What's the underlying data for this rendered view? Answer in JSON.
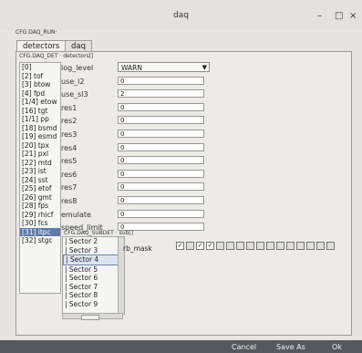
{
  "window": {
    "title": "daq",
    "minimize": "–",
    "maximize": "□",
    "close": "×"
  },
  "cfg_run_label": "CFG.DAQ_RUN·",
  "tabs": [
    {
      "label": "detectors"
    },
    {
      "label": "daq"
    }
  ],
  "detectors_header": "CFG.DAQ_DET · detectors[]",
  "detectors": [
    "[0]",
    "[2] tof",
    "[3] btow",
    "[4] fpd",
    "[1/4] etow",
    "[16] tgt",
    "[1/1] pp",
    "[18] bsmd",
    "[19] esmd",
    "[20] tpx",
    "[21] pxl",
    "[22] mtd",
    "[23] ist",
    "[24] sst",
    "[25] etof",
    "[26] gmt",
    "[28] fps",
    "[29] rhicf",
    "[30] fcs",
    "[31] itpc",
    "[32] stgc"
  ],
  "selected_detector_index": 19,
  "fields": [
    {
      "label": "log_level",
      "value": "WARN",
      "type": "select"
    },
    {
      "label": "use_l2",
      "value": "0"
    },
    {
      "label": "use_sl3",
      "value": "2"
    },
    {
      "label": "res1",
      "value": "0"
    },
    {
      "label": "res2",
      "value": "0"
    },
    {
      "label": "res3",
      "value": "0"
    },
    {
      "label": "res4",
      "value": "0"
    },
    {
      "label": "res5",
      "value": "0"
    },
    {
      "label": "res6",
      "value": "0"
    },
    {
      "label": "res7",
      "value": "0"
    },
    {
      "label": "res8",
      "value": "0"
    },
    {
      "label": "emulate",
      "value": "0"
    },
    {
      "label": "speed_limit",
      "value": "0"
    }
  ],
  "subdet_header": "CFG.DAQ_SUBDET · sub[]",
  "subdets": [
    "| Sector 2",
    "| Sector 3",
    "| Sector 4",
    "| Sector 5",
    "| Sector 6",
    "| Sector 7",
    "| Sector 8",
    "| Sector 9"
  ],
  "selected_subdet_index": 2,
  "rb_mask": {
    "label": "rb_mask",
    "checks": [
      true,
      false,
      true,
      true,
      false,
      false,
      false,
      false,
      false,
      false,
      false,
      false,
      false,
      false,
      false,
      false
    ]
  },
  "buttons": {
    "cancel": "Cancel",
    "save_as": "Save As",
    "ok": "Ok"
  }
}
